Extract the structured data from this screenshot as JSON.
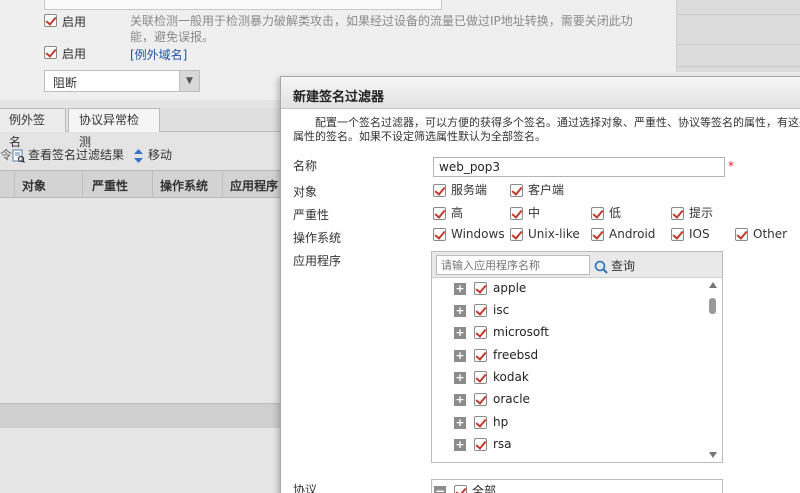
{
  "background": {
    "enable_label_1": "启用",
    "enable_desc": "关联检测一般用于检测暴力破解类攻击，如果经过设备的流量已做过IP地址转换，需要关闭此功能，避免误报。",
    "enable_label_2": "启用",
    "exception_domain_link": "[例外域名]",
    "action_select": "阻断",
    "tabs": [
      {
        "label": "例外签名"
      },
      {
        "label": "协议异常检测"
      }
    ],
    "toolbar": {
      "partial": "令",
      "view_results": "查看签名过滤结果",
      "move": "移动"
    },
    "table_headers": [
      "对象",
      "严重性",
      "操作系统",
      "应用程序"
    ]
  },
  "dialog": {
    "title": "新建签名过滤器",
    "description": "配置一个签名过滤器，可以方便的获得多个签名。通过选择对象、严重性、协议等签名的属性，有这些属性的签名。如果不设定筛选属性默认为全部签名。",
    "labels": {
      "name": "名称",
      "object": "对象",
      "severity": "严重性",
      "os": "操作系统",
      "app": "应用程序",
      "protocol": "协议"
    },
    "name_value": "web_pop3",
    "required_mark": "*",
    "object_options": [
      "服务端",
      "客户端"
    ],
    "severity_options": [
      "高",
      "中",
      "低",
      "提示"
    ],
    "os_options": [
      "Windows",
      "Unix-like",
      "Android",
      "IOS",
      "Other"
    ],
    "app_search_placeholder": "请输入应用程序名称",
    "app_query_label": "查询",
    "app_items": [
      "apple",
      "isc",
      "microsoft",
      "freebsd",
      "kodak",
      "oracle",
      "hp",
      "rsa"
    ],
    "protocol_item": "全部"
  },
  "colors": {
    "check_mark": "#c0392b",
    "link": "#2255aa",
    "required": "#d22233"
  }
}
